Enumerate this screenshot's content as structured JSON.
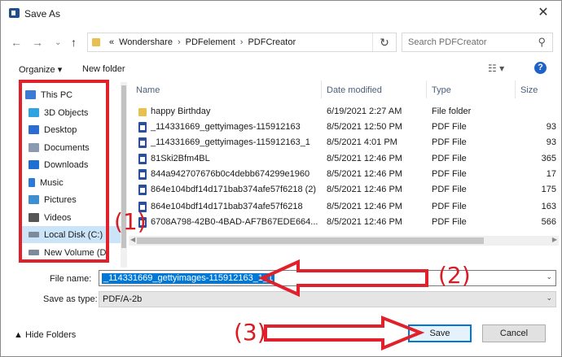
{
  "window": {
    "title": "Save As",
    "close": "✕"
  },
  "nav": {
    "back": "←",
    "forward": "→",
    "up": "↑",
    "breadcrumbs": [
      "«",
      "Wondershare",
      "›",
      "PDFelement",
      "›",
      "PDFCreator"
    ],
    "dropdown": "⌄",
    "refresh": "↻",
    "search_placeholder": "Search PDFCreator",
    "search_icon": "⚲"
  },
  "toolbar": {
    "organize": "Organize ▾",
    "new_folder": "New folder",
    "view": "☷ ▾",
    "help": "?"
  },
  "sidebar": {
    "items": [
      {
        "label": "This PC",
        "icon": "computer-icon",
        "color": "#3a7bd5"
      },
      {
        "label": "3D Objects",
        "icon": "cube-icon",
        "color": "#2fa3e0"
      },
      {
        "label": "Desktop",
        "icon": "desktop-icon",
        "color": "#2d6bd0"
      },
      {
        "label": "Documents",
        "icon": "document-icon",
        "color": "#8a9bb0"
      },
      {
        "label": "Downloads",
        "icon": "download-icon",
        "color": "#1e6fd0"
      },
      {
        "label": "Music",
        "icon": "music-icon",
        "color": "#2a7ad8"
      },
      {
        "label": "Pictures",
        "icon": "pictures-icon",
        "color": "#3e8fd0"
      },
      {
        "label": "Videos",
        "icon": "video-icon",
        "color": "#555555"
      },
      {
        "label": "Local Disk (C:)",
        "icon": "drive-icon",
        "color": "#7d8a99"
      },
      {
        "label": "New Volume (D:",
        "icon": "drive-icon",
        "color": "#7d8a99"
      }
    ]
  },
  "filelist": {
    "columns": [
      "Name",
      "Date modified",
      "Type",
      "Size"
    ],
    "rows": [
      {
        "name": "happy Birthday",
        "date": "6/19/2021 2:27 AM",
        "type": "File folder",
        "size": "",
        "kind": "folder"
      },
      {
        "name": "_114331669_gettyimages-115912163",
        "date": "8/5/2021 12:50 PM",
        "type": "PDF File",
        "size": "93",
        "kind": "pdf"
      },
      {
        "name": "_114331669_gettyimages-115912163_1",
        "date": "8/5/2021 4:01 PM",
        "type": "PDF File",
        "size": "93",
        "kind": "pdf"
      },
      {
        "name": "81Ski2Bfm4BL",
        "date": "8/5/2021 12:46 PM",
        "type": "PDF File",
        "size": "365",
        "kind": "pdf"
      },
      {
        "name": "844a942707676b0c4debb674299e1960",
        "date": "8/5/2021 12:46 PM",
        "type": "PDF File",
        "size": "17",
        "kind": "pdf"
      },
      {
        "name": "864e104bdf14d171bab374afe57f6218 (2)",
        "date": "8/5/2021 12:46 PM",
        "type": "PDF File",
        "size": "175",
        "kind": "pdf"
      },
      {
        "name": "864e104bdf14d171bab374afe57f6218",
        "date": "8/5/2021 12:46 PM",
        "type": "PDF File",
        "size": "163",
        "kind": "pdf"
      },
      {
        "name": "6708A798-42B0-4BAD-AF7B67EDE664...",
        "date": "8/5/2021 12:46 PM",
        "type": "PDF File",
        "size": "566",
        "kind": "pdf"
      }
    ]
  },
  "form": {
    "filename_label": "File name:",
    "filename_value": "_114331669_gettyimages-115912163_1_1",
    "savetype_label": "Save as type:",
    "savetype_value": "PDF/A-2b",
    "dropdown": "⌄"
  },
  "footer": {
    "hide_folders": "▲ Hide Folders",
    "save": "Save",
    "cancel": "Cancel"
  },
  "annotations": {
    "one": "(1)",
    "two": "(2)",
    "three": "(3)",
    "color": "#e0202a"
  }
}
